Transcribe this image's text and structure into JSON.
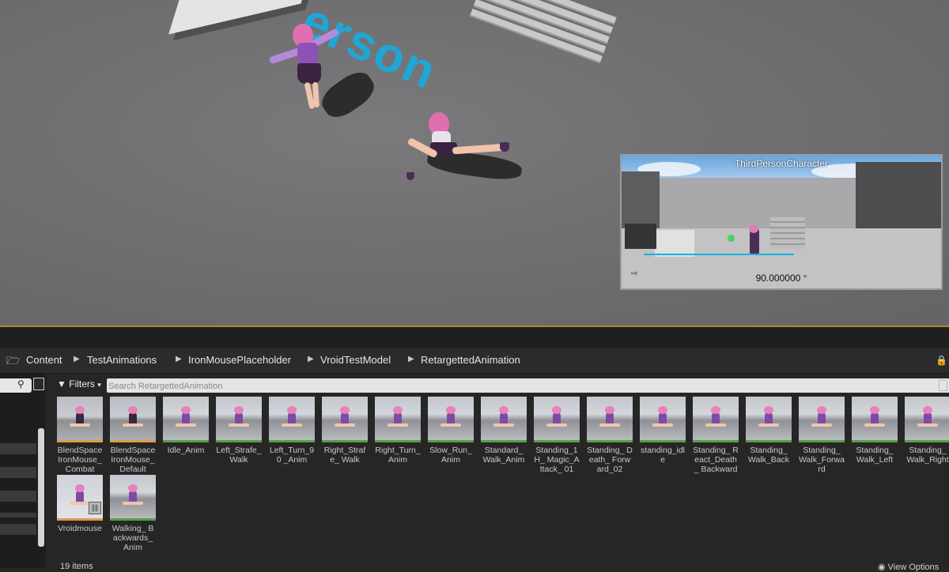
{
  "preview": {
    "title": "ThirdPersonCharacter",
    "value": "90.000000 °"
  },
  "viewport": {
    "floor_text": "erson"
  },
  "breadcrumb": [
    "Content",
    "TestAnimations",
    "IronMousePlaceholder",
    "VroidTestModel",
    "RetargettedAnimation"
  ],
  "filters": {
    "label": "Filters"
  },
  "search": {
    "placeholder": "Search RetargettedAnimation"
  },
  "assets": [
    {
      "label": "BlendSpace IronMouse_ Combat",
      "kind": "blend"
    },
    {
      "label": "BlendSpace IronMouse_ Default",
      "kind": "blend"
    },
    {
      "label": "Idle_Anim",
      "kind": "anim"
    },
    {
      "label": "Left_Strafe_ Walk",
      "kind": "anim"
    },
    {
      "label": "Left_Turn_90 _Anim",
      "kind": "anim"
    },
    {
      "label": "Right_Strafe_ Walk",
      "kind": "anim"
    },
    {
      "label": "Right_Turn_ Anim",
      "kind": "anim"
    },
    {
      "label": "Slow_Run_ Anim",
      "kind": "anim"
    },
    {
      "label": "Standard_ Walk_Anim",
      "kind": "anim"
    },
    {
      "label": "Standing_1H_ Magic_Attack_ 01",
      "kind": "anim"
    },
    {
      "label": "Standing_ Death_ Forward_02",
      "kind": "anim"
    },
    {
      "label": "standing_idle",
      "kind": "anim"
    },
    {
      "label": "Standing_ React_Death_ Backward",
      "kind": "anim"
    },
    {
      "label": "Standing_ Walk_Back",
      "kind": "anim"
    },
    {
      "label": "Standing_ Walk_Forward",
      "kind": "anim"
    },
    {
      "label": "Standing_ Walk_Left",
      "kind": "anim"
    },
    {
      "label": "Standing_ Walk_Right",
      "kind": "anim"
    },
    {
      "label": "Vroidmouse",
      "kind": "mesh"
    },
    {
      "label": "Walking_ Backwards_ Anim",
      "kind": "anim"
    }
  ],
  "footer": {
    "items_count": "19 items",
    "view_options": "View Options"
  },
  "icons": {
    "folder": "folder-icon",
    "search": "search-icon",
    "filter": "filter-icon",
    "lock": "lock-icon",
    "skeleton": "skeleton-icon"
  },
  "colors": {
    "accent": "#b5862a",
    "anim_underline": "#55a04a",
    "blend_underline": "#e19b47",
    "floor_text": "#1ea7d6"
  }
}
